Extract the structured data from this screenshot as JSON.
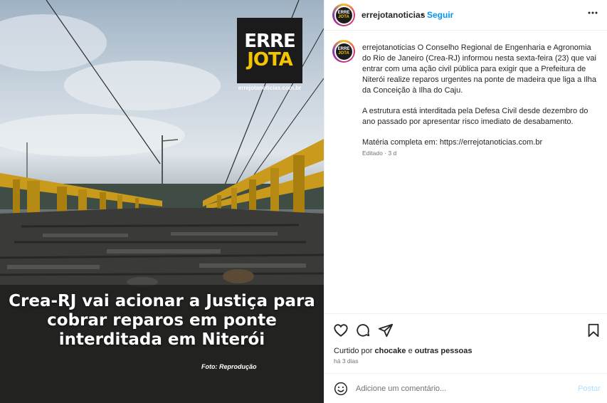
{
  "post_image": {
    "logo_top": "ERRE",
    "logo_bottom": "JOTA",
    "logo_url": "errejotanoticias.com.br",
    "headline": "Crea-RJ vai acionar a Justiça para cobrar reparos em ponte interditada em Niterói",
    "photo_credit": "Foto: Reprodução"
  },
  "header": {
    "username": "errejotanoticias",
    "separator": "•",
    "follow_label": "Seguir",
    "more_icon": "more-horizontal-icon"
  },
  "avatar": {
    "top": "ERRE",
    "bottom": "JOTA"
  },
  "caption": {
    "username": "errejotanoticias",
    "paragraph1": "O Conselho Regional de Engenharia e Agronomia do Rio de Janeiro (Crea-RJ) informou nesta sexta-feira (23) que vai entrar com uma ação civil pública para exigir que a Prefeitura de Niterói realize reparos urgentes na ponte de madeira que liga a Ilha da Conceição à Ilha do Caju.",
    "paragraph2": "A estrutura está interditada pela Defesa Civil desde dezembro do ano passado por apresentar risco imediato de desabamento.",
    "paragraph3": "Matéria completa em: https://errejotanoticias.com.br",
    "edited": "Editado · 3 d"
  },
  "actions": {
    "icons": [
      "heart-icon",
      "comment-icon",
      "share-icon",
      "bookmark-icon"
    ],
    "liked_prefix": "Curtido por ",
    "liked_user": "chocake",
    "liked_suffix": " e ",
    "liked_others": "outras pessoas",
    "time_ago": "há 3 dias"
  },
  "comment": {
    "placeholder": "Adicione um comentário...",
    "post_label": "Postar",
    "emoji_icon": "emoji-icon"
  },
  "colors": {
    "accent_blue": "#0095f6",
    "post_disabled": "#b2dffc",
    "logo_yellow": "#f5c400",
    "muted": "#737373"
  }
}
